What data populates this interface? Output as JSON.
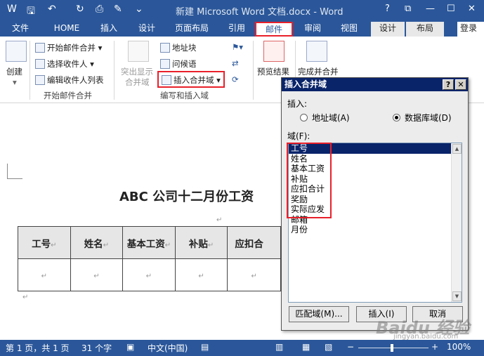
{
  "window": {
    "title": "新建 Microsoft Word 文档.docx - Word",
    "controls": {
      "help": "?",
      "restore": "⧉",
      "minimize": "—",
      "maximize": "☐",
      "close": "✕"
    }
  },
  "tabs": [
    {
      "label": "文件"
    },
    {
      "label": "HOME"
    },
    {
      "label": "插入"
    },
    {
      "label": "设计"
    },
    {
      "label": "页面布局"
    },
    {
      "label": "引用"
    },
    {
      "label": "邮件"
    },
    {
      "label": "审阅"
    },
    {
      "label": "视图"
    },
    {
      "label": "设计"
    },
    {
      "label": "布局"
    }
  ],
  "login": "登录",
  "ribbon": {
    "create": "创建",
    "start_merge": "开始邮件合并",
    "select_recipients": "选择收件人",
    "edit_recipients": "编辑收件人列表",
    "group_start": "开始邮件合并",
    "highlight_fields_l1": "突出显示",
    "highlight_fields_l2": "合并域",
    "address_block": "地址块",
    "greeting": "问候语",
    "insert_merge_field": "插入合并域",
    "group_write": "编写和插入域",
    "preview": "预览结果",
    "finish": "完成并合并"
  },
  "document": {
    "heading": "ABC 公司十二月份工资",
    "return_mark": "↵",
    "columns": [
      "工号",
      "姓名",
      "基本工资",
      "补贴",
      "应扣合"
    ]
  },
  "dialog": {
    "title": "插入合并域",
    "insert_label": "插入:",
    "radio_address": "地址域(A)",
    "radio_database": "数据库域(D)",
    "field_label": "域(F):",
    "fields": [
      "工号",
      "姓名",
      "基本工资",
      "补贴",
      "应扣合计",
      "奖励",
      "实际应发",
      "邮箱",
      "月份"
    ],
    "selected_index": 0,
    "btn_match": "匹配域(M)...",
    "btn_insert": "插入(I)",
    "btn_cancel": "取消"
  },
  "status": {
    "page": "第 1 页，共 1 页",
    "words": "31 个字",
    "lang": "中文(中国)",
    "zoom": "100%"
  },
  "watermark": {
    "brand": "Baidu 经验",
    "url": "jingyan.baidu.com"
  },
  "colors": {
    "accent": "#2b579a",
    "highlight": "#e8202a",
    "dialog_title": "#0a246a"
  }
}
